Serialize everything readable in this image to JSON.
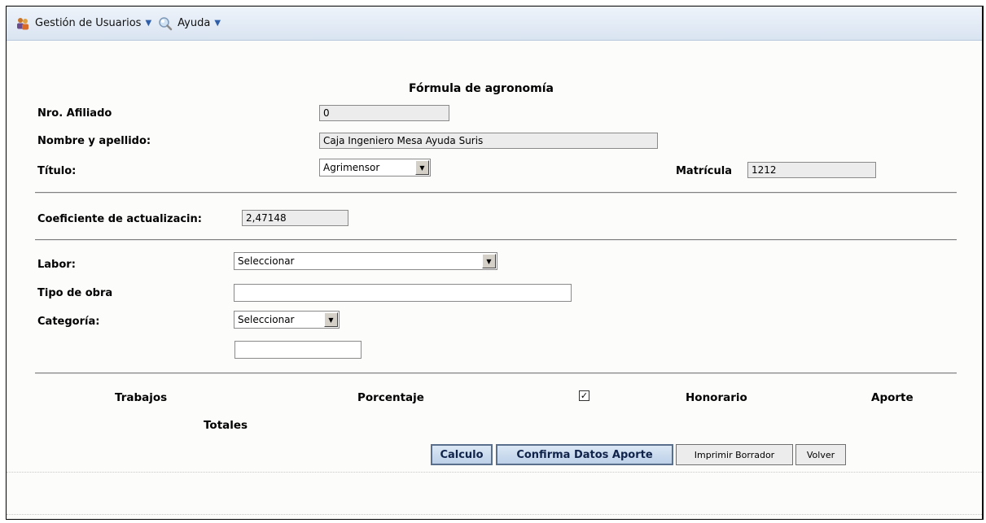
{
  "menu": {
    "items": [
      {
        "label": "Gestión de Usuarios",
        "icon": "users-icon"
      },
      {
        "label": "Ayuda",
        "icon": "magnifier-icon"
      }
    ]
  },
  "form": {
    "title": "Fórmula de agronomía",
    "afiliado": {
      "label": "Nro. Afiliado",
      "value": "0"
    },
    "nombre": {
      "label": "Nombre y apellido:",
      "value": "Caja Ingeniero Mesa Ayuda Suris"
    },
    "titulo": {
      "label": "Título:",
      "selected": "Agrimensor"
    },
    "matricula": {
      "label": "Matrícula",
      "value": "1212"
    },
    "coeficiente": {
      "label": "Coeficiente de actualizacin:",
      "value": "2,47148"
    },
    "labor": {
      "label": "Labor:",
      "selected": "Seleccionar"
    },
    "tipo_obra": {
      "label": "Tipo de obra",
      "value": ""
    },
    "categoria": {
      "label": "Categoría:",
      "selected": "Seleccionar"
    },
    "extra_value": ""
  },
  "table": {
    "columns": [
      "Trabajos",
      "Porcentaje",
      "Honorario",
      "Aporte"
    ],
    "checkbox_checked": true,
    "totals_label": "Totales"
  },
  "buttons": {
    "calculo": "Calculo",
    "confirma": "Confirma Datos Aporte",
    "imprimir": "Imprimir Borrador",
    "volver": "Volver"
  }
}
